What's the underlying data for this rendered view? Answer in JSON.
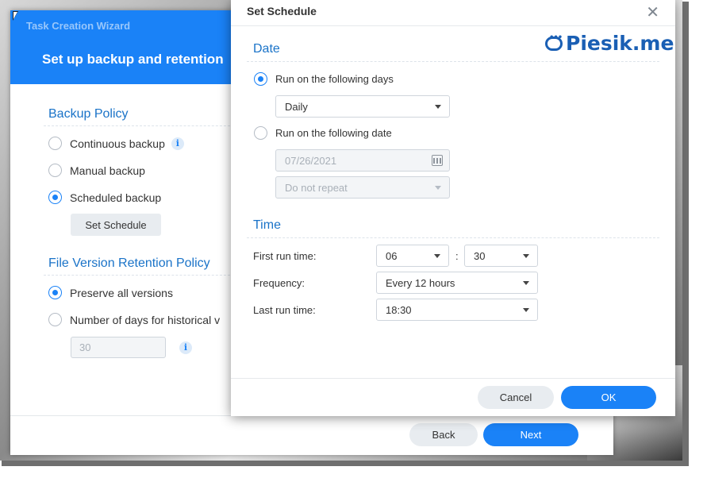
{
  "wizard": {
    "window_title": "Task Creation Wizard",
    "heading": "Set up backup and retention",
    "backup_policy": {
      "title": "Backup Policy",
      "options": [
        "Continuous backup",
        "Manual backup",
        "Scheduled backup"
      ],
      "selected": "Scheduled backup",
      "set_schedule_label": "Set Schedule"
    },
    "retention_policy": {
      "title": "File Version Retention Policy",
      "options": [
        "Preserve all versions",
        "Number of days for historical v"
      ],
      "selected": "Preserve all versions",
      "days_placeholder": "30"
    },
    "back_label": "Back",
    "next_label": "Next"
  },
  "modal": {
    "title": "Set Schedule",
    "date": {
      "title": "Date",
      "run_days_label": "Run on the following days",
      "run_days_value": "Daily",
      "run_date_label": "Run on the following date",
      "date_value": "07/26/2021",
      "repeat_value": "Do not repeat",
      "selected": "Run on the following days"
    },
    "time": {
      "title": "Time",
      "first_run_label": "First run time:",
      "first_run_hour": "06",
      "first_run_sep": ":",
      "first_run_minute": "30",
      "frequency_label": "Frequency:",
      "frequency_value": "Every 12 hours",
      "last_run_label": "Last run time:",
      "last_run_value": "18:30"
    },
    "cancel_label": "Cancel",
    "ok_label": "OK"
  },
  "watermark": "Piesik.me",
  "colors": {
    "accent": "#1a82f7",
    "section_title": "#1a73c8",
    "watermark": "#1a5fb4"
  },
  "icons": [
    "info-icon",
    "close-icon",
    "chevron-down-icon",
    "calendar-icon",
    "cursor-icon"
  ]
}
